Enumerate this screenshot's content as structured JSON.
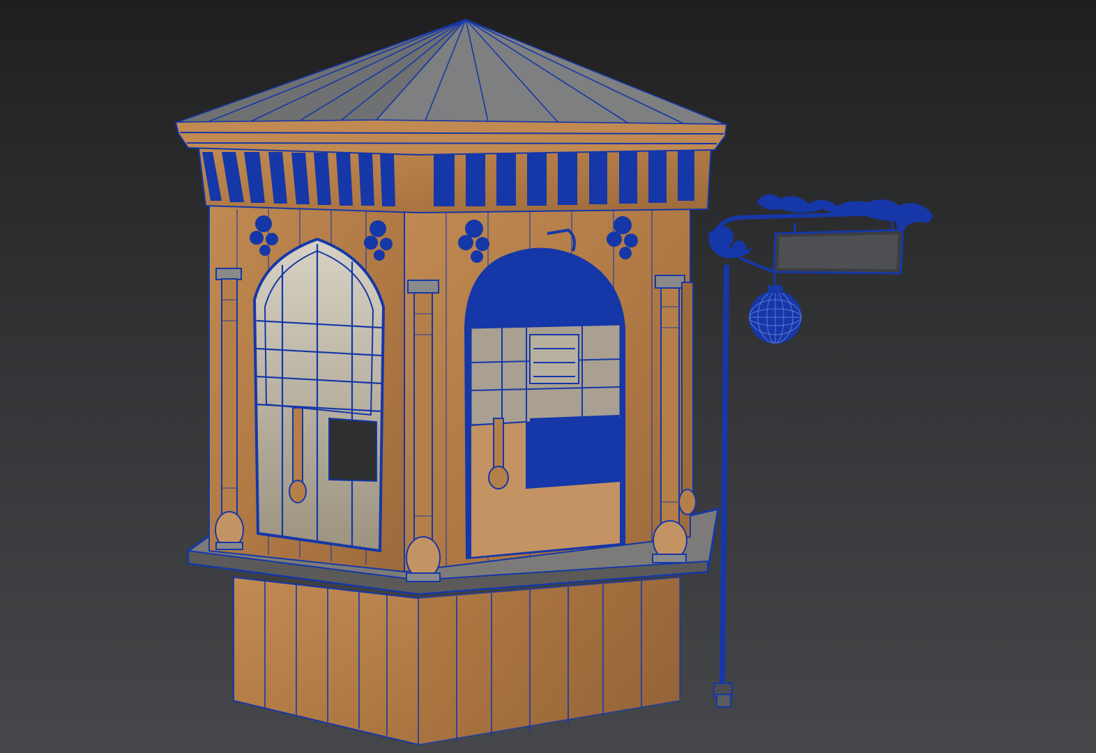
{
  "scene": {
    "view_description": "",
    "colors": {
      "background_top": "#1f1f20",
      "background_bottom": "#45474a",
      "wood": "#b57f4a",
      "wood_dark": "#8f5f33",
      "roof": "#727273",
      "roof_dark": "#4f5052",
      "wire": "#1537a8",
      "glass": "#cfc4aa",
      "sign": "#3b3c3f"
    },
    "sign": {
      "line1": "",
      "line2": ""
    }
  }
}
